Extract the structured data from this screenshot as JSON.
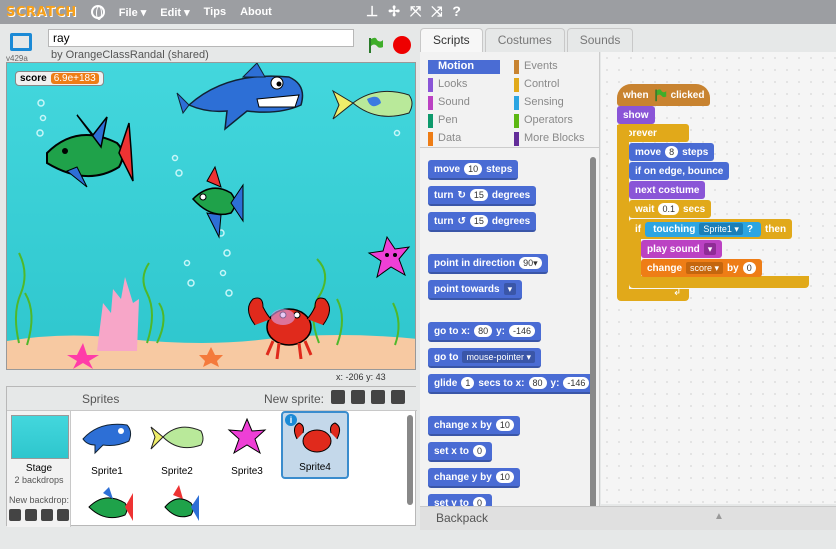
{
  "menubar": {
    "logo": "SCRATCH",
    "file": "File ▾",
    "edit": "Edit ▾",
    "tips": "Tips",
    "about": "About",
    "tool_icons": [
      "stamp-icon",
      "cut-icon",
      "grow-icon",
      "shrink-icon",
      "help-icon"
    ]
  },
  "stage_header": {
    "version": "v429a",
    "project_title": "ray",
    "author": "by OrangeClassRandal (shared)"
  },
  "stage": {
    "score_label": "score",
    "score_value": "6.9e+183",
    "mouse_x_label": "x:",
    "mouse_x": "-206",
    "mouse_y_label": "y:",
    "mouse_y": "43"
  },
  "sprites_pane": {
    "title": "Sprites",
    "new_sprite_label": "New sprite:",
    "stage_label": "Stage",
    "backdrop_count": "2 backdrops",
    "new_backdrop_label": "New backdrop:",
    "sprites": [
      {
        "name": "Sprite1",
        "selected": false
      },
      {
        "name": "Sprite2",
        "selected": false
      },
      {
        "name": "Sprite3",
        "selected": false
      },
      {
        "name": "Sprite4",
        "selected": true
      }
    ]
  },
  "tabs": [
    "Scripts",
    "Costumes",
    "Sounds"
  ],
  "categories": {
    "left": [
      "Motion",
      "Looks",
      "Sound",
      "Pen",
      "Data"
    ],
    "right": [
      "Events",
      "Control",
      "Sensing",
      "Operators",
      "More Blocks"
    ]
  },
  "palette_blocks": {
    "move": {
      "label": "move",
      "value": "10",
      "suffix": "steps"
    },
    "turn_right": {
      "label": "turn",
      "value": "15",
      "suffix": "degrees"
    },
    "turn_left": {
      "label": "turn",
      "value": "15",
      "suffix": "degrees"
    },
    "point_direction": {
      "label": "point in direction",
      "value": "90▾"
    },
    "point_towards": {
      "label": "point towards",
      "value": "▾"
    },
    "goto_xy": {
      "label": "go to x:",
      "x": "80",
      "ylabel": "y:",
      "y": "-146"
    },
    "goto_target": {
      "label": "go to",
      "value": "mouse-pointer ▾"
    },
    "glide": {
      "label": "glide",
      "secs": "1",
      "mid": "secs to x:",
      "x": "80",
      "ylabel": "y:",
      "y": "-146"
    },
    "change_x": {
      "label": "change x by",
      "value": "10"
    },
    "set_x": {
      "label": "set x to",
      "value": "0"
    },
    "change_y": {
      "label": "change y by",
      "value": "10"
    },
    "set_y": {
      "label": "set y to",
      "value": "0"
    }
  },
  "script": {
    "when_flag": {
      "pre": "when",
      "post": "clicked"
    },
    "show": "show",
    "forever": "forever",
    "move": {
      "label": "move",
      "value": "8",
      "suffix": "steps"
    },
    "bounce": "if on edge, bounce",
    "next_costume": "next costume",
    "wait": {
      "label": "wait",
      "value": "0.1",
      "suffix": "secs"
    },
    "if": {
      "label": "if",
      "touching": "touching",
      "target": "Sprite1 ▾",
      "q": "?",
      "then": "then"
    },
    "play_sound": {
      "label": "play sound",
      "value": "▾"
    },
    "change_score": {
      "label": "change",
      "var": "score ▾",
      "by": "by",
      "value": "0"
    }
  },
  "backpack": {
    "label": "Backpack"
  }
}
